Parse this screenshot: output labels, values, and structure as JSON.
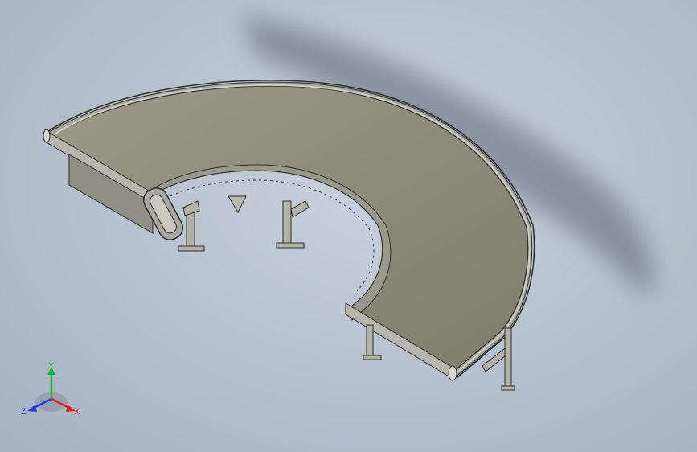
{
  "viewport": {
    "model": "curved-belt-conveyor"
  },
  "triad": {
    "x_label": "X",
    "y_label": "Y",
    "z_label": "Z",
    "x_color": "#e02020",
    "y_color": "#20b040",
    "z_color": "#2040e0"
  },
  "colors": {
    "belt": "#8a8a78",
    "frame": "#9c9c92",
    "edge": "#2e2e2a",
    "shadow": "#5d6673"
  }
}
